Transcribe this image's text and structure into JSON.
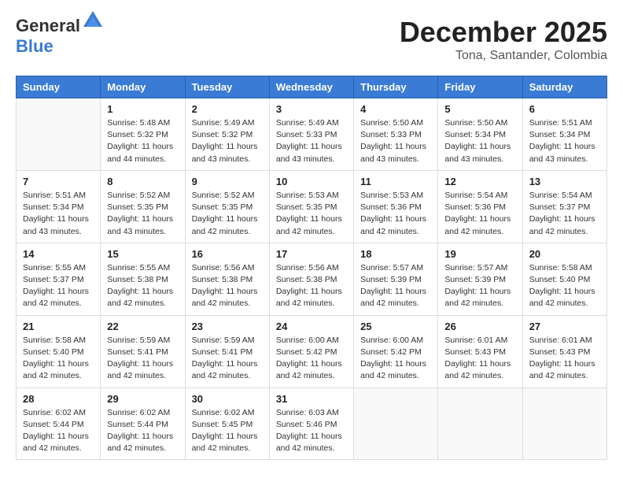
{
  "header": {
    "logo_general": "General",
    "logo_blue": "Blue",
    "main_title": "December 2025",
    "sub_title": "Tona, Santander, Colombia"
  },
  "days_of_week": [
    "Sunday",
    "Monday",
    "Tuesday",
    "Wednesday",
    "Thursday",
    "Friday",
    "Saturday"
  ],
  "weeks": [
    [
      {
        "day": "",
        "info": ""
      },
      {
        "day": "1",
        "info": "Sunrise: 5:48 AM\nSunset: 5:32 PM\nDaylight: 11 hours\nand 44 minutes."
      },
      {
        "day": "2",
        "info": "Sunrise: 5:49 AM\nSunset: 5:32 PM\nDaylight: 11 hours\nand 43 minutes."
      },
      {
        "day": "3",
        "info": "Sunrise: 5:49 AM\nSunset: 5:33 PM\nDaylight: 11 hours\nand 43 minutes."
      },
      {
        "day": "4",
        "info": "Sunrise: 5:50 AM\nSunset: 5:33 PM\nDaylight: 11 hours\nand 43 minutes."
      },
      {
        "day": "5",
        "info": "Sunrise: 5:50 AM\nSunset: 5:34 PM\nDaylight: 11 hours\nand 43 minutes."
      },
      {
        "day": "6",
        "info": "Sunrise: 5:51 AM\nSunset: 5:34 PM\nDaylight: 11 hours\nand 43 minutes."
      }
    ],
    [
      {
        "day": "7",
        "info": "Sunrise: 5:51 AM\nSunset: 5:34 PM\nDaylight: 11 hours\nand 43 minutes."
      },
      {
        "day": "8",
        "info": "Sunrise: 5:52 AM\nSunset: 5:35 PM\nDaylight: 11 hours\nand 43 minutes."
      },
      {
        "day": "9",
        "info": "Sunrise: 5:52 AM\nSunset: 5:35 PM\nDaylight: 11 hours\nand 42 minutes."
      },
      {
        "day": "10",
        "info": "Sunrise: 5:53 AM\nSunset: 5:35 PM\nDaylight: 11 hours\nand 42 minutes."
      },
      {
        "day": "11",
        "info": "Sunrise: 5:53 AM\nSunset: 5:36 PM\nDaylight: 11 hours\nand 42 minutes."
      },
      {
        "day": "12",
        "info": "Sunrise: 5:54 AM\nSunset: 5:36 PM\nDaylight: 11 hours\nand 42 minutes."
      },
      {
        "day": "13",
        "info": "Sunrise: 5:54 AM\nSunset: 5:37 PM\nDaylight: 11 hours\nand 42 minutes."
      }
    ],
    [
      {
        "day": "14",
        "info": "Sunrise: 5:55 AM\nSunset: 5:37 PM\nDaylight: 11 hours\nand 42 minutes."
      },
      {
        "day": "15",
        "info": "Sunrise: 5:55 AM\nSunset: 5:38 PM\nDaylight: 11 hours\nand 42 minutes."
      },
      {
        "day": "16",
        "info": "Sunrise: 5:56 AM\nSunset: 5:38 PM\nDaylight: 11 hours\nand 42 minutes."
      },
      {
        "day": "17",
        "info": "Sunrise: 5:56 AM\nSunset: 5:38 PM\nDaylight: 11 hours\nand 42 minutes."
      },
      {
        "day": "18",
        "info": "Sunrise: 5:57 AM\nSunset: 5:39 PM\nDaylight: 11 hours\nand 42 minutes."
      },
      {
        "day": "19",
        "info": "Sunrise: 5:57 AM\nSunset: 5:39 PM\nDaylight: 11 hours\nand 42 minutes."
      },
      {
        "day": "20",
        "info": "Sunrise: 5:58 AM\nSunset: 5:40 PM\nDaylight: 11 hours\nand 42 minutes."
      }
    ],
    [
      {
        "day": "21",
        "info": "Sunrise: 5:58 AM\nSunset: 5:40 PM\nDaylight: 11 hours\nand 42 minutes."
      },
      {
        "day": "22",
        "info": "Sunrise: 5:59 AM\nSunset: 5:41 PM\nDaylight: 11 hours\nand 42 minutes."
      },
      {
        "day": "23",
        "info": "Sunrise: 5:59 AM\nSunset: 5:41 PM\nDaylight: 11 hours\nand 42 minutes."
      },
      {
        "day": "24",
        "info": "Sunrise: 6:00 AM\nSunset: 5:42 PM\nDaylight: 11 hours\nand 42 minutes."
      },
      {
        "day": "25",
        "info": "Sunrise: 6:00 AM\nSunset: 5:42 PM\nDaylight: 11 hours\nand 42 minutes."
      },
      {
        "day": "26",
        "info": "Sunrise: 6:01 AM\nSunset: 5:43 PM\nDaylight: 11 hours\nand 42 minutes."
      },
      {
        "day": "27",
        "info": "Sunrise: 6:01 AM\nSunset: 5:43 PM\nDaylight: 11 hours\nand 42 minutes."
      }
    ],
    [
      {
        "day": "28",
        "info": "Sunrise: 6:02 AM\nSunset: 5:44 PM\nDaylight: 11 hours\nand 42 minutes."
      },
      {
        "day": "29",
        "info": "Sunrise: 6:02 AM\nSunset: 5:44 PM\nDaylight: 11 hours\nand 42 minutes."
      },
      {
        "day": "30",
        "info": "Sunrise: 6:02 AM\nSunset: 5:45 PM\nDaylight: 11 hours\nand 42 minutes."
      },
      {
        "day": "31",
        "info": "Sunrise: 6:03 AM\nSunset: 5:46 PM\nDaylight: 11 hours\nand 42 minutes."
      },
      {
        "day": "",
        "info": ""
      },
      {
        "day": "",
        "info": ""
      },
      {
        "day": "",
        "info": ""
      }
    ]
  ]
}
